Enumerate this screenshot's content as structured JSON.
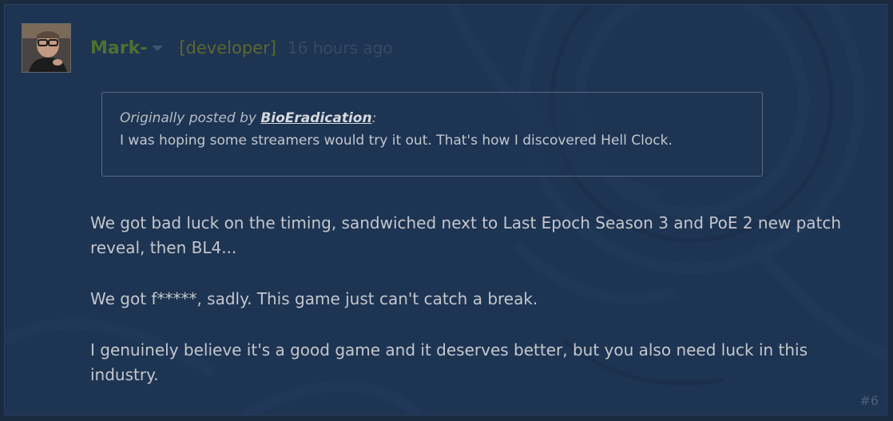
{
  "post": {
    "author": "Mark-",
    "dev_tag": "[developer]",
    "time": "16 hours ago",
    "quote": {
      "prefix": "Originally posted by ",
      "author": "BioEradication",
      "suffix": ":",
      "text": "I was hoping some streamers would try it out. That's how I discovered Hell Clock."
    },
    "paragraphs": [
      "We got bad luck on the timing, sandwiched next to Last Epoch Season 3 and PoE 2 new patch reveal, then BL4...",
      "We got f*****, sadly. This game just can't catch a break.",
      "I genuinely believe it's a good game and it deserves better, but you also need luck in this industry."
    ],
    "number": "#6"
  },
  "icons": {
    "avatar": "avatar-photo",
    "dropdown": "chevron-down-icon"
  },
  "colors": {
    "background": "#1e3453",
    "author_name": "#4e7030",
    "dev_tag": "#5d682f",
    "body_text": "#c3c7cc"
  }
}
